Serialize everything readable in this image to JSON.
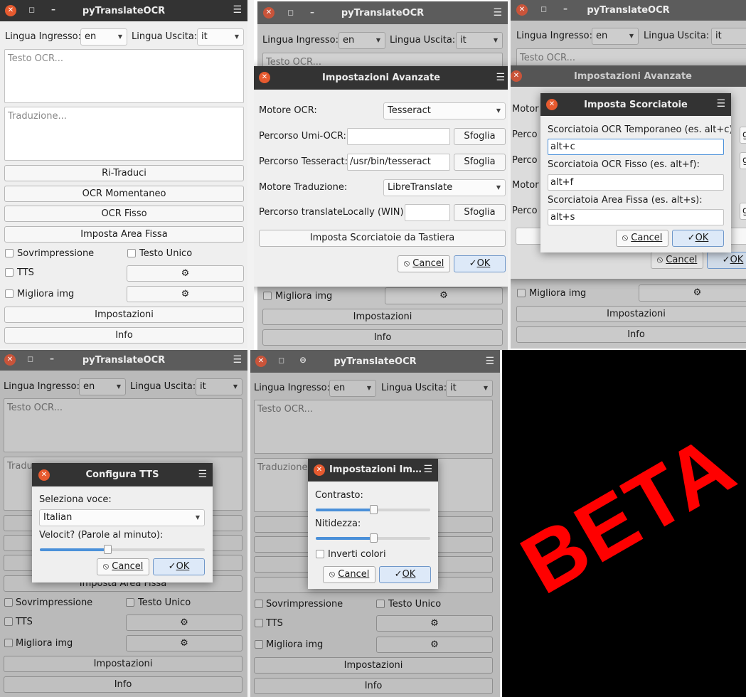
{
  "app_title": "pyTranslateOCR",
  "main": {
    "lingua_ingresso_label": "Lingua Ingresso:",
    "lingua_ingresso_value": "en",
    "lingua_uscita_label": "Lingua Uscita:",
    "lingua_uscita_value": "it",
    "ocr_placeholder": "Testo OCR...",
    "translation_placeholder": "Traduzione...",
    "ritraduci": "Ri-Traduci",
    "ocr_momentaneo": "OCR Momentaneo",
    "ocr_fisso": "OCR Fisso",
    "imposta_area_fissa": "Imposta Area Fissa",
    "sovrimpressione": "Sovrimpressione",
    "testo_unico": "Testo Unico",
    "tts": "TTS",
    "migliora_img": "Migliora img",
    "gear": "⚙",
    "impostazioni": "Impostazioni",
    "info": "Info"
  },
  "advanced": {
    "title": "Impostazioni Avanzate",
    "title_truncated": "Impostazioni Im…",
    "motore_ocr_label": "Motore OCR:",
    "motore_ocr_value": "Tesseract",
    "percorso_umi_label": "Percorso Umi-OCR:",
    "percorso_umi_value": "",
    "percorso_tesseract_label": "Percorso Tesseract:",
    "percorso_tesseract_value": "/usr/bin/tesseract",
    "motore_traduzione_label": "Motore Traduzione:",
    "motore_traduzione_value": "LibreTranslate",
    "percorso_translatelocally_label": "Percorso translateLocally (WIN):",
    "percorso_translatelocally_value": "",
    "sfoglia": "Sfoglia",
    "imposta_scorciatoie": "Imposta Scorciatoie da Tastiera",
    "cancel": "Cancel",
    "ok": "OK",
    "bg_labels": [
      "Motor",
      "Perco",
      "Perco",
      "Motor",
      "Perco"
    ],
    "bg_right_labels": [
      "glia",
      "glia",
      "glia"
    ]
  },
  "shortcuts": {
    "title": "Imposta Scorciatoie",
    "ocr_temporaneo_label": "Scorciatoia OCR Temporaneo (es. alt+c):",
    "ocr_temporaneo_value": "alt+c",
    "ocr_fisso_label": "Scorciatoia OCR Fisso (es. alt+f):",
    "ocr_fisso_value": "alt+f",
    "area_fissa_label": "Scorciatoia Area Fissa (es. alt+s):",
    "area_fissa_value": "alt+s"
  },
  "tts_dialog": {
    "title": "Configura TTS",
    "seleziona_voce_label": "Seleziona voce:",
    "voice_value": "Italian",
    "velocita_label": "Velocit? (Parole al minuto):",
    "speed_fraction": 0.41,
    "bg_traduz": "Traduz"
  },
  "image_dialog": {
    "contrasto_label": "Contrasto:",
    "contrasto_fraction": 0.5,
    "nitidezza_label": "Nitidezza:",
    "nitidezza_fraction": 0.5,
    "inverti_colori": "Inverti colori",
    "bg_traduzione": "Traduzione"
  },
  "watermark": {
    "text": "BETA",
    "color": "#ff0000"
  },
  "colors": {
    "titlebar": "#333333",
    "close": "#e65a2f",
    "ok_bg": "#dde9f8",
    "slider": "#4a90d9"
  }
}
